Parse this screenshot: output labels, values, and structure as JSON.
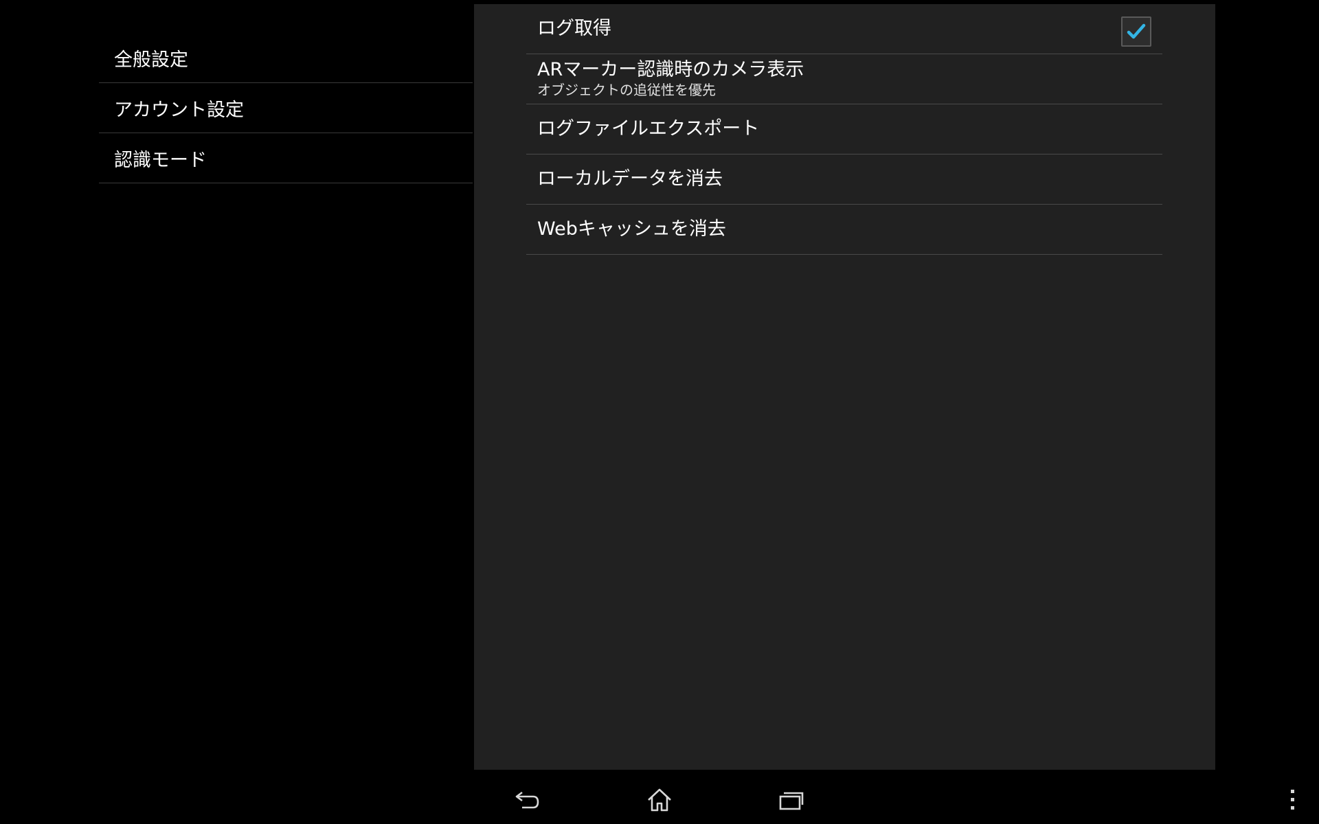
{
  "headers": {
    "items": [
      {
        "label": "全般設定"
      },
      {
        "label": "アカウント設定"
      },
      {
        "label": "認識モード"
      }
    ]
  },
  "prefs": {
    "log": {
      "title": "ログ取得",
      "checked": true
    },
    "camera": {
      "title": "ARマーカー認識時のカメラ表示",
      "summary": "オブジェクトの追従性を優先"
    },
    "export": {
      "title": "ログファイルエクスポート"
    },
    "clear_local": {
      "title": "ローカルデータを消去"
    },
    "clear_web": {
      "title": "Webキャッシュを消去"
    }
  },
  "icons": {
    "checkmark": "checkmark-icon",
    "back": "back-icon",
    "home": "home-icon",
    "recents": "recent-apps-icon",
    "menu": "overflow-menu-icon"
  },
  "colors": {
    "accent": "#33b5e5",
    "panel": "#212121",
    "background": "#000000"
  }
}
